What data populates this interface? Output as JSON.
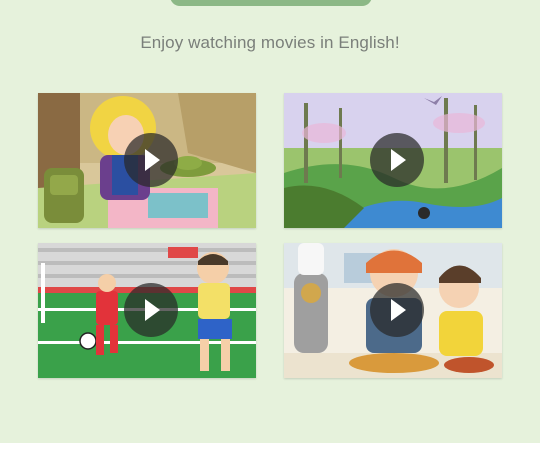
{
  "page": {
    "heading": "Enjoy watching movies in English!"
  },
  "videos": [
    {
      "id": "video-1",
      "scene": "girl-picnic",
      "icon": "play-icon"
    },
    {
      "id": "video-2",
      "scene": "forest-stream",
      "icon": "play-icon"
    },
    {
      "id": "video-3",
      "scene": "soccer-match",
      "icon": "play-icon"
    },
    {
      "id": "video-4",
      "scene": "robot-chef-cooking",
      "icon": "play-icon"
    }
  ],
  "colors": {
    "background": "#e6f2dc",
    "heading_text": "#7a7f7a",
    "top_pill": "#8cb886",
    "play_button": "#282828"
  }
}
